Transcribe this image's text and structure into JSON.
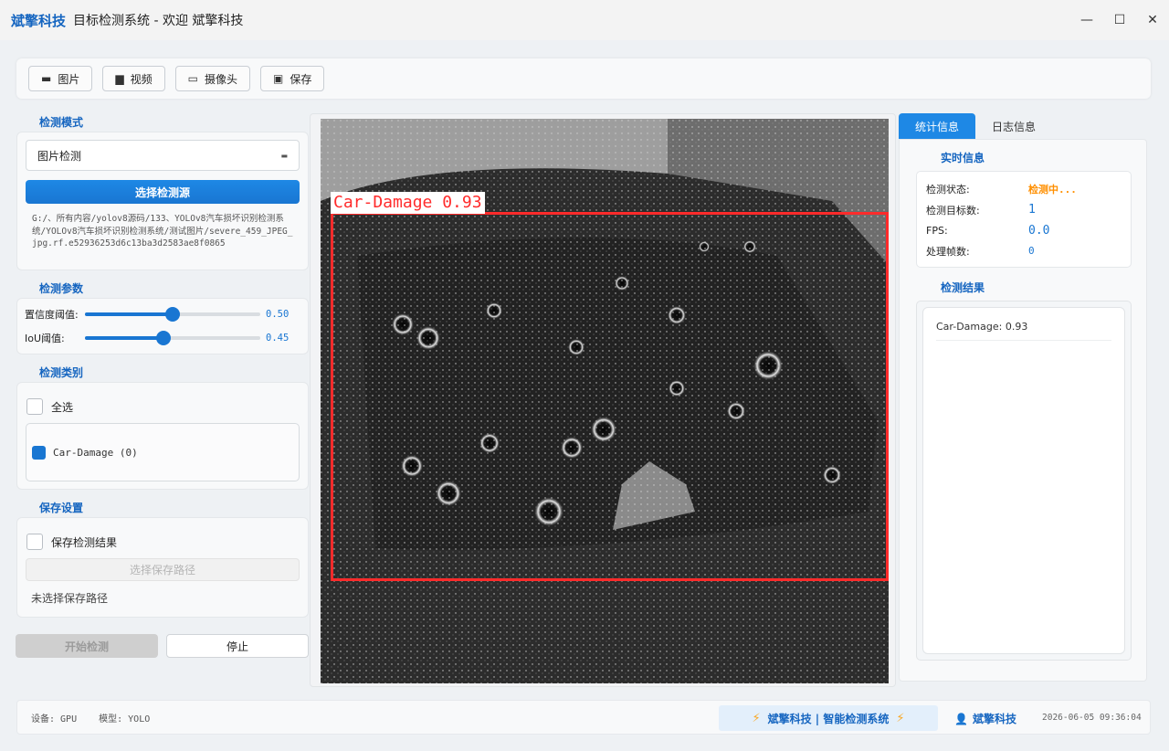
{
  "window": {
    "brand": "斌擎科技",
    "title": "目标检测系统 - 欢迎 斌擎科技",
    "controls": [
      "—",
      "☐",
      "✕"
    ]
  },
  "toolbar": {
    "buttons": [
      {
        "icon": "image-icon",
        "glyph": "▬",
        "label": "图片"
      },
      {
        "icon": "video-icon",
        "glyph": "▆",
        "label": "视频"
      },
      {
        "icon": "camera-icon",
        "glyph": "▭",
        "label": "摄像头"
      },
      {
        "icon": "save-icon",
        "glyph": "▣",
        "label": "保存"
      }
    ]
  },
  "left": {
    "mode_title": "检测模式",
    "mode_value": "图片检测",
    "select_source": "选择检测源",
    "source_path": "G:/、所有内容/yolov8源码/133、YOLOv8汽车损坏识别检测系统/YOLOv8汽车损坏识别检测系统/测试图片/severe_459_JPEG_jpg.rf.e52936253d6c13ba3d2583ae8f0865",
    "params_title": "检测参数",
    "confidence_label": "置信度阈值:",
    "confidence_value": "0.50",
    "confidence": 0.5,
    "iou_label": "IoU阈值:",
    "iou_value": "0.45",
    "iou": 0.45,
    "classes_title": "检测类别",
    "select_all": "全选",
    "class_item": "Car-Damage (0)",
    "save_title": "保存设置",
    "save_results": "保存检测结果",
    "choose_path": "选择保存路径",
    "no_path": "未选择保存路径",
    "start": "开始检测",
    "stop": "停止"
  },
  "detection": {
    "label": "Car-Damage 0.93"
  },
  "right": {
    "tabs": [
      "统计信息",
      "日志信息"
    ],
    "realtime_title": "实时信息",
    "rows": [
      {
        "key": "检测状态:",
        "value": "检测中..."
      },
      {
        "key": "检测目标数:",
        "value": "1"
      },
      {
        "key": "FPS:",
        "value": "0.0"
      },
      {
        "key": "处理帧数:",
        "value": "0"
      }
    ],
    "results_title": "检测结果",
    "result_item": "Car-Damage: 0.93"
  },
  "status": {
    "device": "设备: GPU",
    "model": "模型: YOLO",
    "banner": "斌擎科技 | 智能检测系统",
    "user": "斌擎科技",
    "datetime": "2026-06-05 09:36:04"
  },
  "colors": {
    "accent": "#1976d2",
    "brand": "#1565c0",
    "detection_box": "#ff2b2b",
    "status_running": "#ff8f00"
  }
}
